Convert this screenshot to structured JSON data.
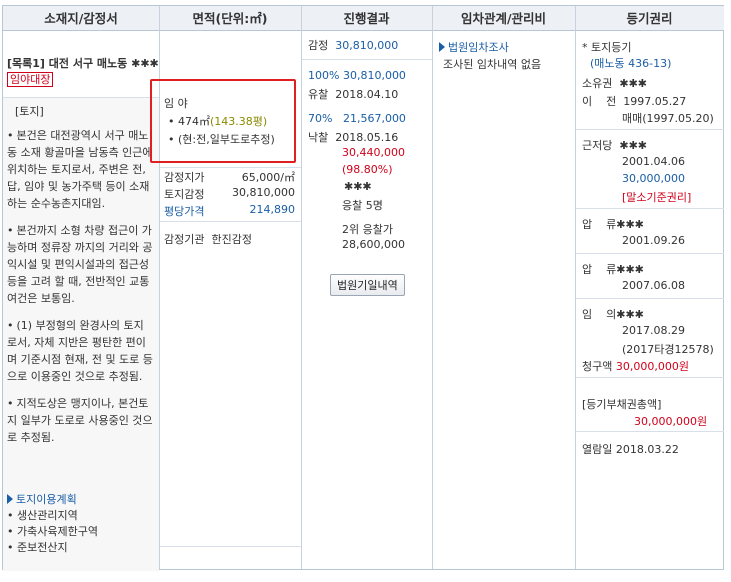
{
  "headers": [
    "소재지/감정서",
    "면적(단위:㎡)",
    "진행결과",
    "임차관계/관리비",
    "등기권리"
  ],
  "location": {
    "item_no": "[목록1]",
    "address": "대전 서구 매노동 ✱✱✱",
    "badge": "임야대장",
    "section": "[토지]",
    "descriptions": [
      "본건은 대전광역시 서구 매노동 소재 황골마을 남동측 인근에 위치하는 토지로서, 주변은 전, 답, 임야 및 농가주택 등이 소재하는 순수농촌지대임.",
      "본건까지 소형 차량 접근이 가능하며 정류장 까지의 거리와 공익시설 및 편익시설과의 접근성 등을 고려 할 때, 전반적인 교통 여건은 보통임.",
      "(1) 부정형의 완경사의 토지로서, 자체 지반은 평탄한 편이며 기준시점 현재, 전 및 도로 등으로 이용중인 것으로 추정됨.",
      "지적도상은 맹지이나, 본건토지 일부가 도로로 사용중인 것으로 추정됨."
    ],
    "land_plan_title": "토지이용계획",
    "land_plan_items": [
      "생산관리지역",
      "가축사육제한구역",
      "준보전산지"
    ]
  },
  "area": {
    "category": "임 야",
    "size": "474㎡",
    "pyeong": "(143.38평)",
    "note": "(현:전,일부도로추정)",
    "unit_price_label": "감정지가",
    "unit_price": "65,000/㎡",
    "appraisal_label": "토지감정",
    "appraisal": "30,810,000",
    "pyeong_price_label": "평당가격",
    "pyeong_price": "214,890",
    "appraiser_label": "감정기관",
    "appraiser": "한진감정"
  },
  "progress": {
    "appraisal_label": "감정",
    "appraisal_value": "30,810,000",
    "r1_pct": "100%",
    "r1_value": "30,810,000",
    "r1_result": "유찰",
    "r1_date": "2018.04.10",
    "r2_pct": "70%",
    "r2_value": "21,567,000",
    "r2_result": "낙찰",
    "r2_date": "2018.05.16",
    "winning_bid": "30,440,000",
    "winning_ratio": "(98.80%)",
    "winner": "✱✱✱",
    "bidders": "응찰 5명",
    "second_label": "2위 응찰가",
    "second_value": "28,600,000",
    "button": "법원기일내역"
  },
  "tenancy": {
    "link": "법원임차조사",
    "text": "조사된 임차내역 없음"
  },
  "registry": {
    "title": "* 토지등기",
    "parcel": "(매노동 436-13)",
    "owner_label": "소유권",
    "owner_name": "✱✱✱",
    "transfer_label": "이    전",
    "transfer_date": "1997.05.27",
    "transfer_cause": "매매(1997.05.20)",
    "mortgage_label": "근저당",
    "mortgage_name": "✱✱✱",
    "mortgage_date": "2001.04.06",
    "mortgage_amount": "30,000,000",
    "mortgage_note": "[말소기준권리]",
    "seizure1_label": "압    류",
    "seizure1_name": "✱✱✱",
    "seizure1_date": "2001.09.26",
    "seizure2_label": "압    류",
    "seizure2_name": "✱✱✱",
    "seizure2_date": "2007.06.08",
    "voluntary_label": "임    의",
    "voluntary_name": "✱✱✱",
    "voluntary_date": "2017.08.29",
    "voluntary_case": "(2017타경12578)",
    "claim_label": "청구액",
    "claim_amount": "30,000,000원",
    "total_label": "[등기부채권총액]",
    "total_amount": "30,000,000원",
    "view_date_label": "열람일",
    "view_date": "2018.03.22"
  }
}
